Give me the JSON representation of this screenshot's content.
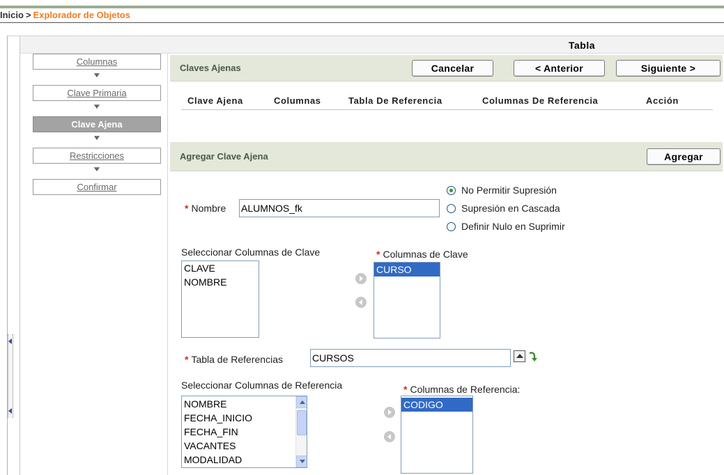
{
  "breadcrumb": {
    "home": "Inicio",
    "separator": ">",
    "current": "Explorador de Objetos"
  },
  "window": {
    "title": "Tabla"
  },
  "steps": [
    {
      "label": "Columnas",
      "state": "link"
    },
    {
      "label": "Clave Primaria",
      "state": "link"
    },
    {
      "label": "Clave Ajena",
      "state": "active"
    },
    {
      "label": "Restricciones",
      "state": "link"
    },
    {
      "label": "Confirmar",
      "state": "link"
    }
  ],
  "claves": {
    "title": "Claves Ajenas",
    "buttons": {
      "cancel": "Cancelar",
      "previous": "< Anterior",
      "next": "Siguiente >"
    },
    "columns": [
      "Clave Ajena",
      "Columnas",
      "Tabla De Referencia",
      "Columnas De Referencia",
      "Acción"
    ]
  },
  "agregar": {
    "title": "Agregar Clave Ajena",
    "add_button": "Agregar",
    "nombre": {
      "label": "Nombre",
      "value": "ALUMNOS_fk"
    },
    "delete_options": [
      {
        "label": "No Permitir Supresión",
        "checked": true
      },
      {
        "label": "Supresión en Cascada",
        "checked": false
      },
      {
        "label": "Definir Nulo en Suprimir",
        "checked": false
      }
    ],
    "select_key_columns": {
      "label": "Seleccionar Columnas de Clave",
      "options": [
        "CLAVE",
        "NOMBRE"
      ]
    },
    "key_columns": {
      "label": "Columnas de Clave",
      "options": [
        "CURSO"
      ]
    },
    "reference_table": {
      "label": "Tabla de Referencias",
      "value": "CURSOS"
    },
    "select_ref_columns": {
      "label": "Seleccionar Columnas de Referencia",
      "options": [
        "NOMBRE",
        "FECHA_INICIO",
        "FECHA_FIN",
        "VACANTES",
        "MODALIDAD"
      ]
    },
    "ref_columns": {
      "label": "Columnas de Referencia:",
      "options": [
        "CODIGO"
      ]
    }
  },
  "colors": {
    "accent": "#f47c20",
    "section_bg": "#e3e8da",
    "active_step": "#a3a3a3",
    "selection": "#316ac5",
    "required": "#d7261b"
  }
}
